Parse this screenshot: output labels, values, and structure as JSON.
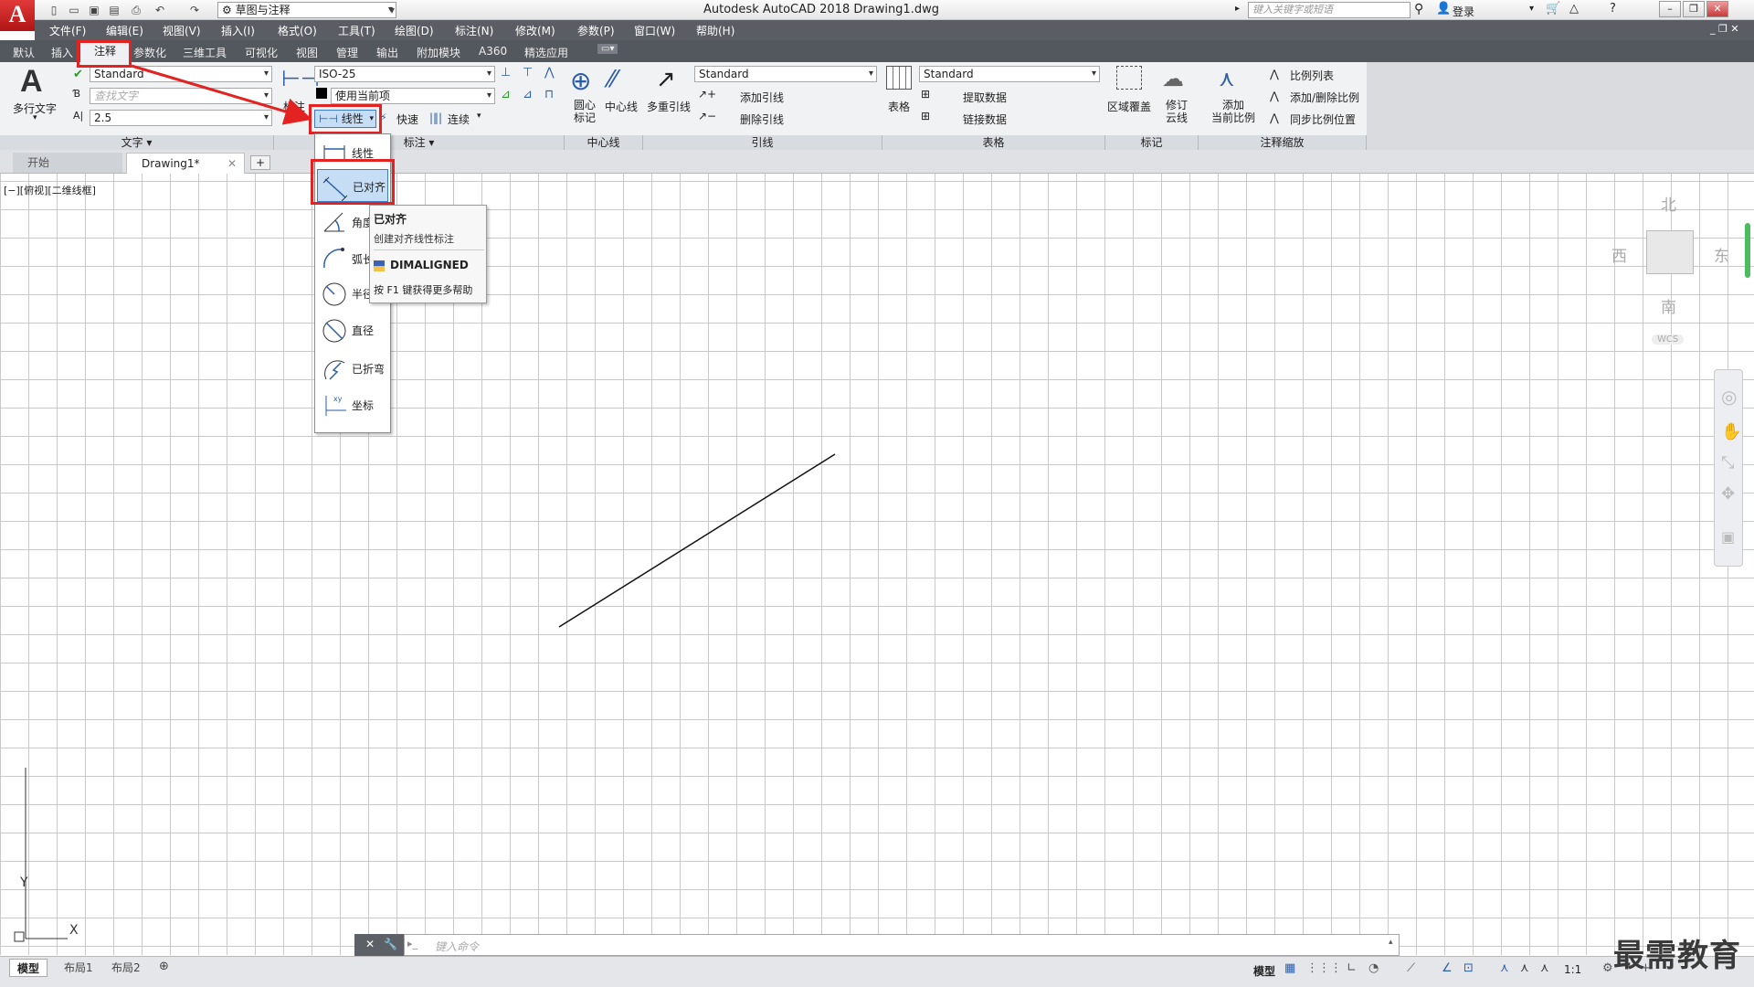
{
  "app": {
    "logo": "A",
    "title": "Autodesk AutoCAD 2018    Drawing1.dwg",
    "workspace": "草图与注释",
    "search_placeholder": "键入关键字或短语",
    "login": "登录"
  },
  "menubar": [
    "文件(F)",
    "编辑(E)",
    "视图(V)",
    "插入(I)",
    "格式(O)",
    "工具(T)",
    "绘图(D)",
    "标注(N)",
    "修改(M)",
    "参数(P)",
    "窗口(W)",
    "帮助(H)"
  ],
  "ribbon_tabs": [
    "默认",
    "插入",
    "注释",
    "参数化",
    "三维工具",
    "可视化",
    "视图",
    "管理",
    "输出",
    "附加模块",
    "A360",
    "精选应用"
  ],
  "ribbon_tabs_active": "注释",
  "text_panel": {
    "mtext_label": "多行文字",
    "style": "Standard",
    "find_placeholder": "查找文字",
    "height": "2.5",
    "title": "文字"
  },
  "dim_panel": {
    "big_label": "标注",
    "dim_style": "ISO-25",
    "layer": "使用当前项",
    "linear_button": "线性",
    "quick": "快速",
    "continue": "连续",
    "title": "标注"
  },
  "centerline_panel": {
    "center_mark": "圆心\n标记",
    "centerline": "中心线",
    "title": "中心线"
  },
  "leader_panel": {
    "multileader": "多重引线",
    "style": "Standard",
    "add": "添加引线",
    "remove": "删除引线",
    "title": "引线"
  },
  "table_panel": {
    "table": "表格",
    "style": "Standard",
    "extract": "提取数据",
    "link": "链接数据",
    "title": "表格"
  },
  "markup_panel": {
    "wipeout": "区域覆盖",
    "revcloud": "修订\n云线",
    "title": "标记"
  },
  "scale_panel": {
    "add_current": "添加\n当前比例",
    "scale_list": "比例列表",
    "add_remove": "添加/删除比例",
    "sync": "同步比例位置",
    "title": "注释缩放"
  },
  "doc_tabs": {
    "start": "开始",
    "drawing": "Drawing1*"
  },
  "viewport_label": "[−][俯视][二维线框]",
  "dim_menu": [
    "线性",
    "已对齐",
    "角度",
    "弧长",
    "半径",
    "直径",
    "已折弯",
    "坐标"
  ],
  "dim_menu_visible_labels": [
    "线性",
    "已对齐",
    "角度",
    "弧长",
    "半径",
    "直径",
    "已折弯",
    "坐标"
  ],
  "tooltip": {
    "title": "已对齐",
    "desc": "创建对齐线性标注",
    "command": "DIMALIGNED",
    "help": "按 F1 键获得更多帮助"
  },
  "viewcube": {
    "north": "北",
    "south": "南",
    "east": "东",
    "west": "西",
    "wcs": "WCS"
  },
  "ucs": {
    "x": "X",
    "y": "Y"
  },
  "command_placeholder": "键入命令",
  "layout_tabs": [
    "模型",
    "布局1",
    "布局2"
  ],
  "status": {
    "model": "模型",
    "scale": "1:1"
  },
  "watermark": "最需教育",
  "colors": {
    "highlight": "#e32322",
    "menubar": "#5a5d63",
    "active_item": "#c5def5"
  }
}
